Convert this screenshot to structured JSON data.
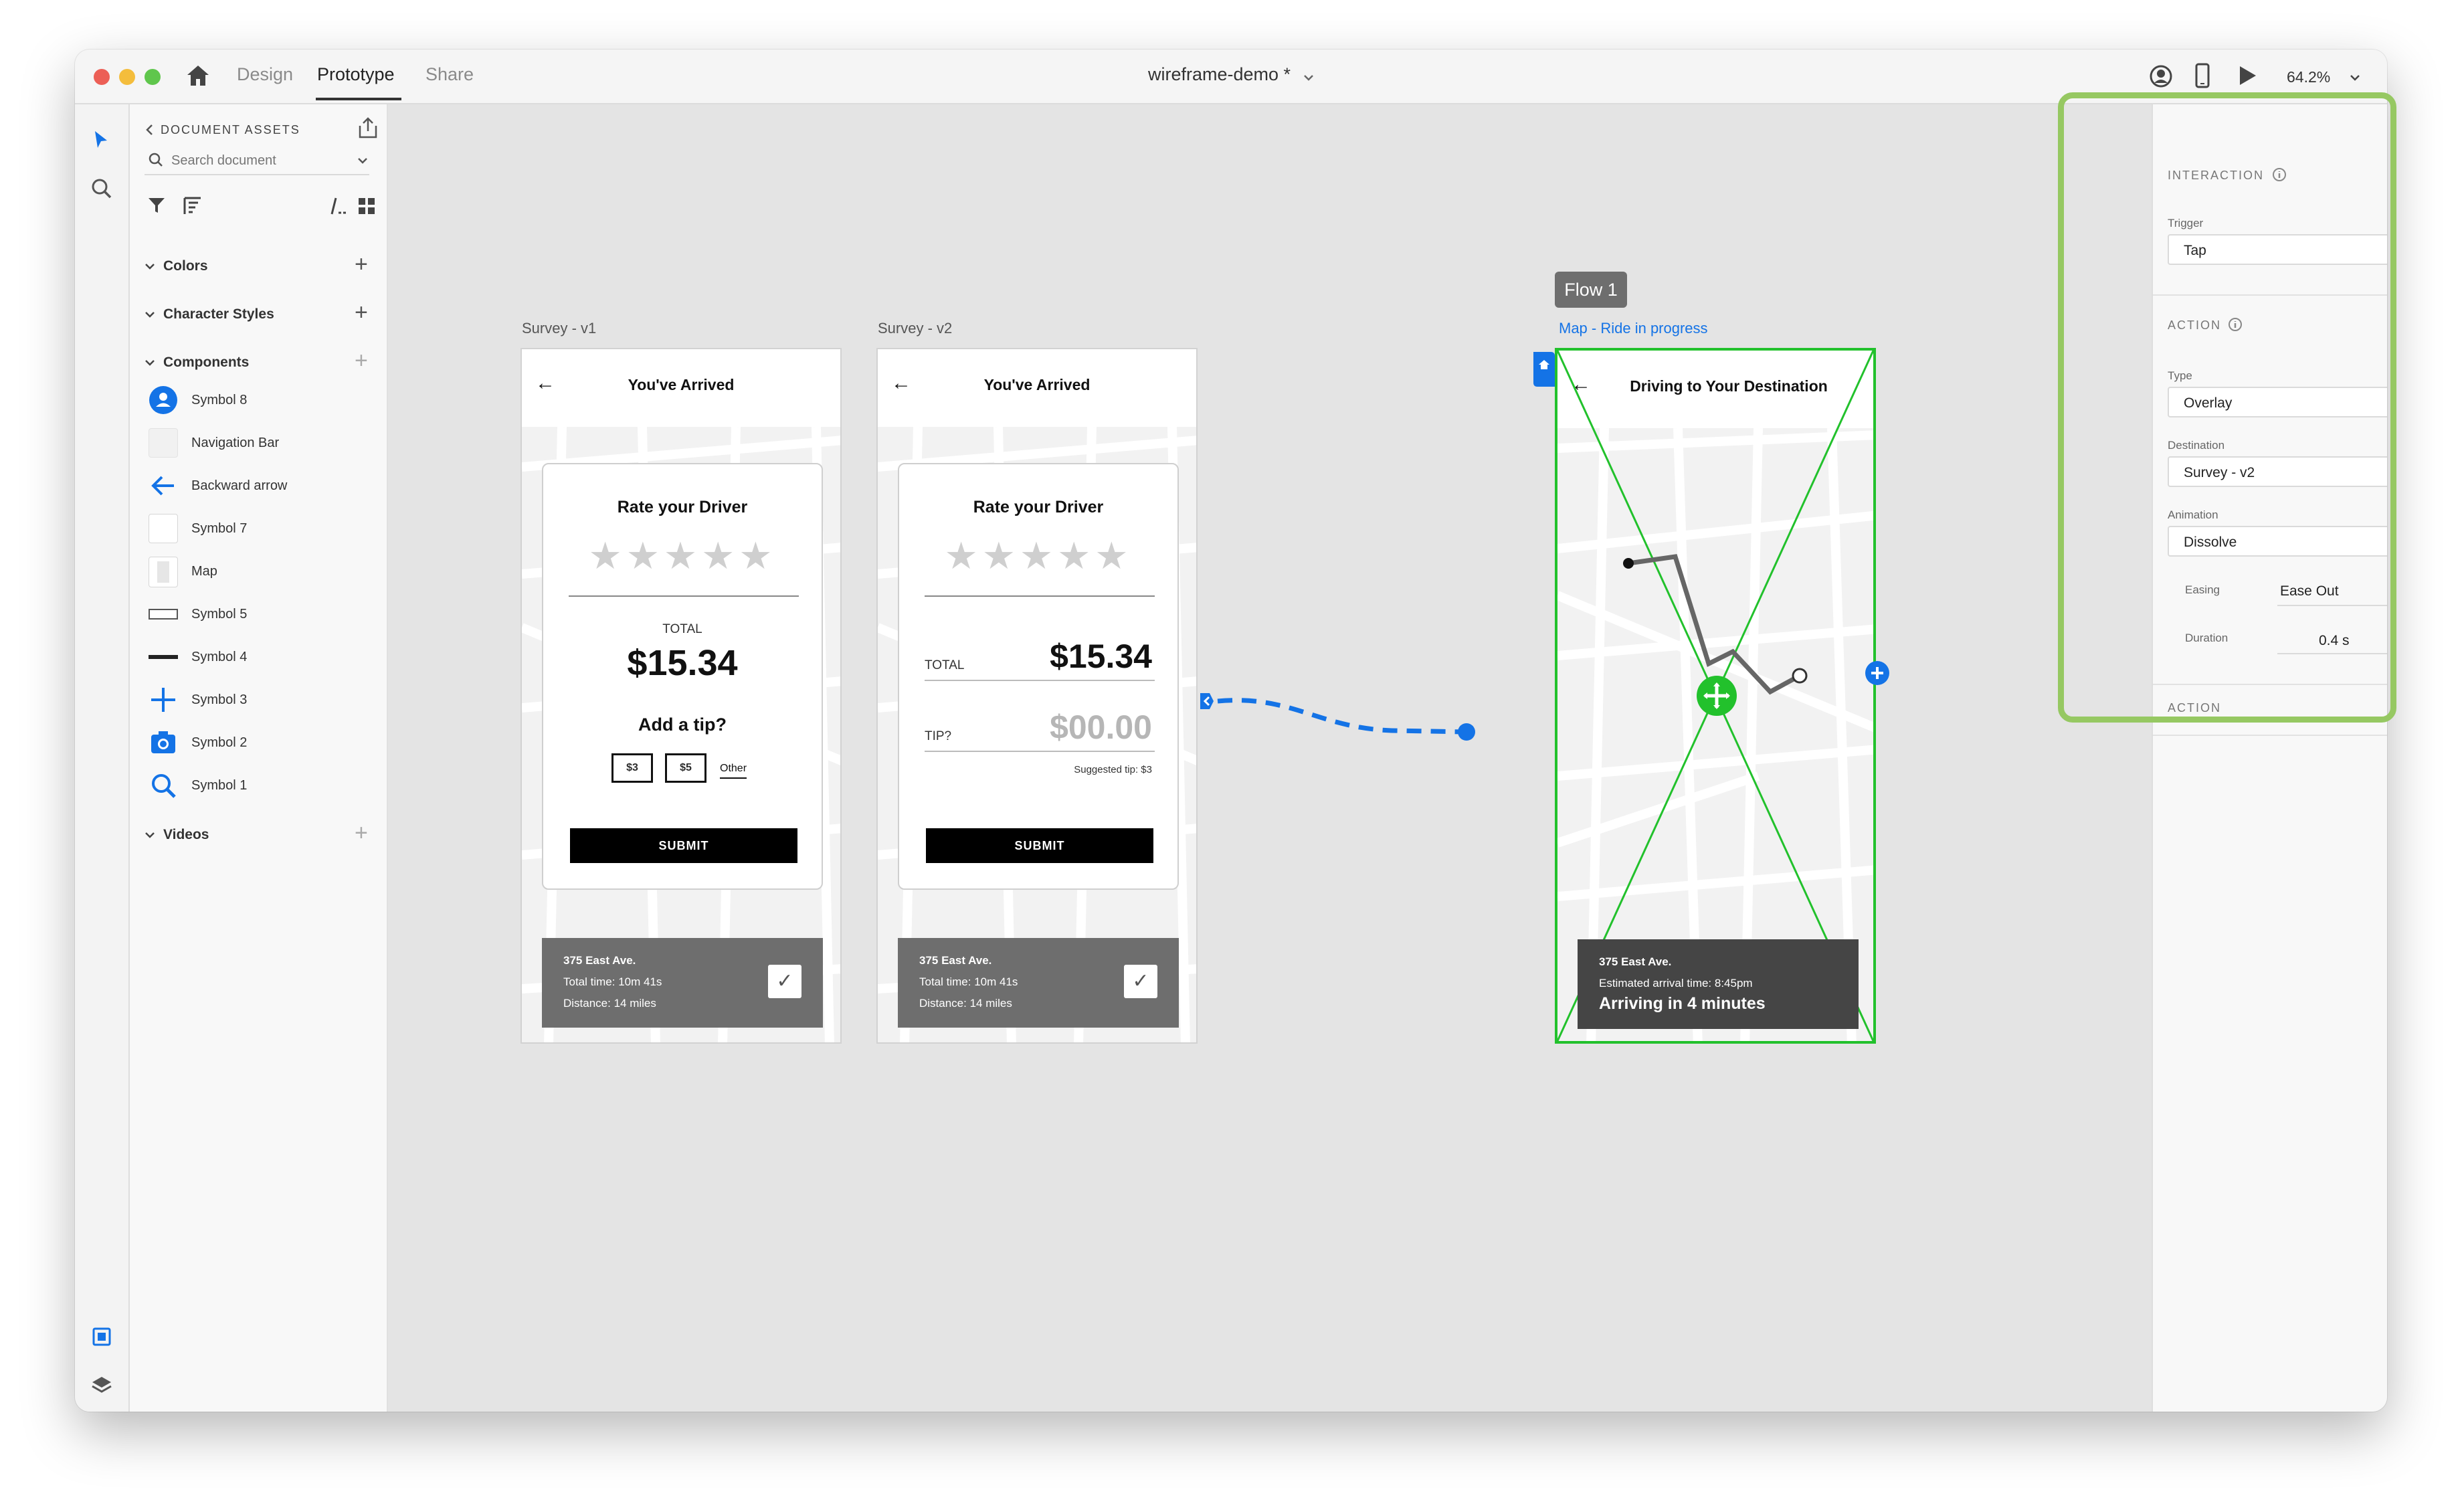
{
  "window": {
    "nav_tabs": [
      "Design",
      "Prototype",
      "Share"
    ],
    "active_tab": "Prototype",
    "doc_title": "wireframe-demo *",
    "zoom": "64.2%"
  },
  "assets": {
    "header": "DOCUMENT ASSETS",
    "search_placeholder": "Search document",
    "sections": {
      "colors": "Colors",
      "character_styles": "Character Styles",
      "components": "Components",
      "videos": "Videos"
    },
    "components": [
      {
        "label": "Symbol 8",
        "icon": "person-icon"
      },
      {
        "label": "Navigation Bar",
        "icon": "nav-bar-thumb"
      },
      {
        "label": "Backward arrow",
        "icon": "back-arrow-icon"
      },
      {
        "label": "Symbol 7",
        "icon": "blank-thumb"
      },
      {
        "label": "Map",
        "icon": "map-thumb"
      },
      {
        "label": "Symbol 5",
        "icon": "button-thumb"
      },
      {
        "label": "Symbol 4",
        "icon": "line-thumb"
      },
      {
        "label": "Symbol 3",
        "icon": "plus-icon"
      },
      {
        "label": "Symbol 2",
        "icon": "camera-icon"
      },
      {
        "label": "Symbol 1",
        "icon": "search-icon"
      }
    ]
  },
  "canvas": {
    "artboard_v1": {
      "label": "Survey - v1",
      "title": "You've Arrived",
      "card_title": "Rate your Driver",
      "total_label": "TOTAL",
      "total_amount": "$15.34",
      "tip_question": "Add a tip?",
      "tip_options": [
        "$3",
        "$5",
        "Other"
      ],
      "submit": "SUBMIT",
      "footer": {
        "address": "375 East Ave.",
        "time": "Total time: 10m 41s",
        "distance": "Distance: 14 miles"
      }
    },
    "artboard_v2": {
      "label": "Survey - v2",
      "title": "You've Arrived",
      "card_title": "Rate your Driver",
      "total_label": "TOTAL",
      "total_amount": "$15.34",
      "tip_label": "TIP?",
      "tip_amount": "$00.00",
      "suggested_tip": "Suggested tip: $3",
      "submit": "SUBMIT",
      "footer": {
        "address": "375 East Ave.",
        "time": "Total time: 10m 41s",
        "distance": "Distance: 14 miles"
      }
    },
    "artboard_map": {
      "flow_badge": "Flow 1",
      "label": "Map - Ride in progress",
      "title": "Driving to Your Destination",
      "footer": {
        "address": "375 East Ave.",
        "eta": "Estimated arrival time: 8:45pm",
        "arriving": "Arriving in 4 minutes"
      }
    }
  },
  "inspector": {
    "interaction_title": "INTERACTION",
    "trigger_label": "Trigger",
    "trigger_value": "Tap",
    "action_title": "ACTION",
    "type_label": "Type",
    "type_value": "Overlay",
    "destination_label": "Destination",
    "destination_value": "Survey - v2",
    "animation_label": "Animation",
    "animation_value": "Dissolve",
    "easing_label": "Easing",
    "easing_value": "Ease Out",
    "duration_label": "Duration",
    "duration_value": "0.4 s",
    "action2_title": "ACTION"
  },
  "colors": {
    "accent_blue": "#1473e6",
    "highlight_green": "#96c862",
    "route_green": "#22c12c"
  }
}
